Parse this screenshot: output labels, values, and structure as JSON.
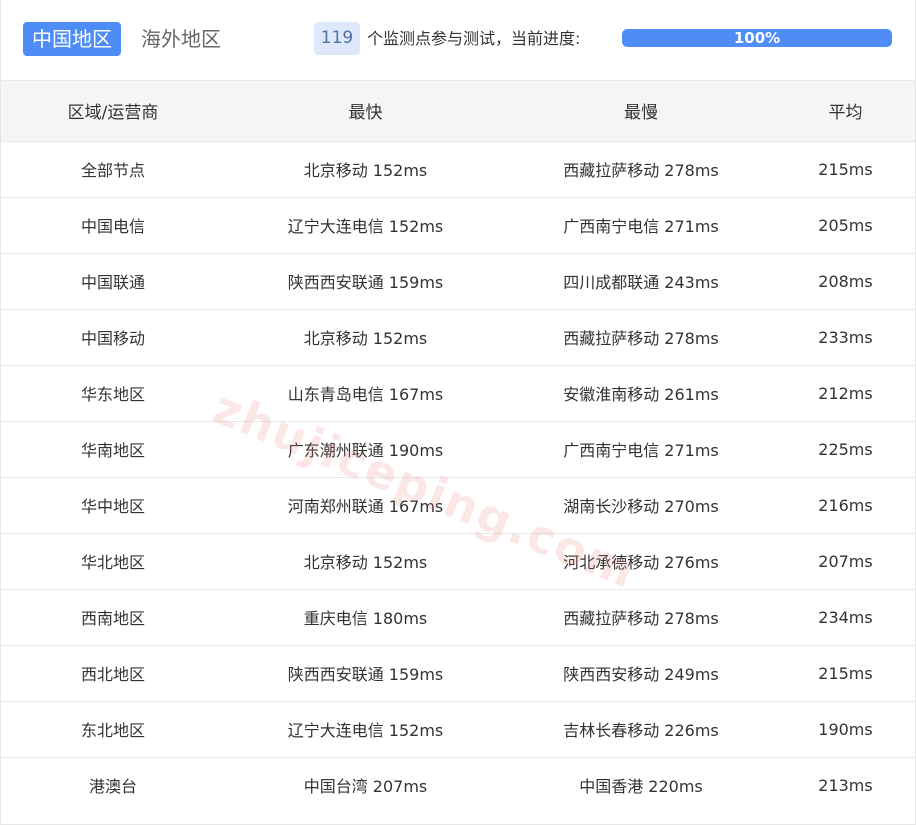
{
  "tabs": {
    "active": "中国地区",
    "inactive": "海外地区"
  },
  "status": {
    "count": "119",
    "text": "个监测点参与测试，当前进度:",
    "progress_label": "100%",
    "progress_value": 100
  },
  "table": {
    "headers": [
      "区域/运营商",
      "最快",
      "最慢",
      "平均"
    ],
    "rows": [
      [
        "全部节点",
        "北京移动 152ms",
        "西藏拉萨移动 278ms",
        "215ms"
      ],
      [
        "中国电信",
        "辽宁大连电信 152ms",
        "广西南宁电信 271ms",
        "205ms"
      ],
      [
        "中国联通",
        "陕西西安联通 159ms",
        "四川成都联通 243ms",
        "208ms"
      ],
      [
        "中国移动",
        "北京移动 152ms",
        "西藏拉萨移动 278ms",
        "233ms"
      ],
      [
        "华东地区",
        "山东青岛电信 167ms",
        "安徽淮南移动 261ms",
        "212ms"
      ],
      [
        "华南地区",
        "广东潮州联通 190ms",
        "广西南宁电信 271ms",
        "225ms"
      ],
      [
        "华中地区",
        "河南郑州联通 167ms",
        "湖南长沙移动 270ms",
        "216ms"
      ],
      [
        "华北地区",
        "北京移动 152ms",
        "河北承德移动 276ms",
        "207ms"
      ],
      [
        "西南地区",
        "重庆电信 180ms",
        "西藏拉萨移动 278ms",
        "234ms"
      ],
      [
        "西北地区",
        "陕西西安联通 159ms",
        "陕西西安移动 249ms",
        "215ms"
      ],
      [
        "东北地区",
        "辽宁大连电信 152ms",
        "吉林长春移动 226ms",
        "190ms"
      ],
      [
        "港澳台",
        "中国台湾 207ms",
        "中国香港 220ms",
        "213ms"
      ]
    ]
  },
  "watermark": "zhujiceping.com",
  "colors": {
    "accent": "#4d8df5",
    "badge_bg": "#dde9fb",
    "header_bg": "#f5f5f5"
  }
}
